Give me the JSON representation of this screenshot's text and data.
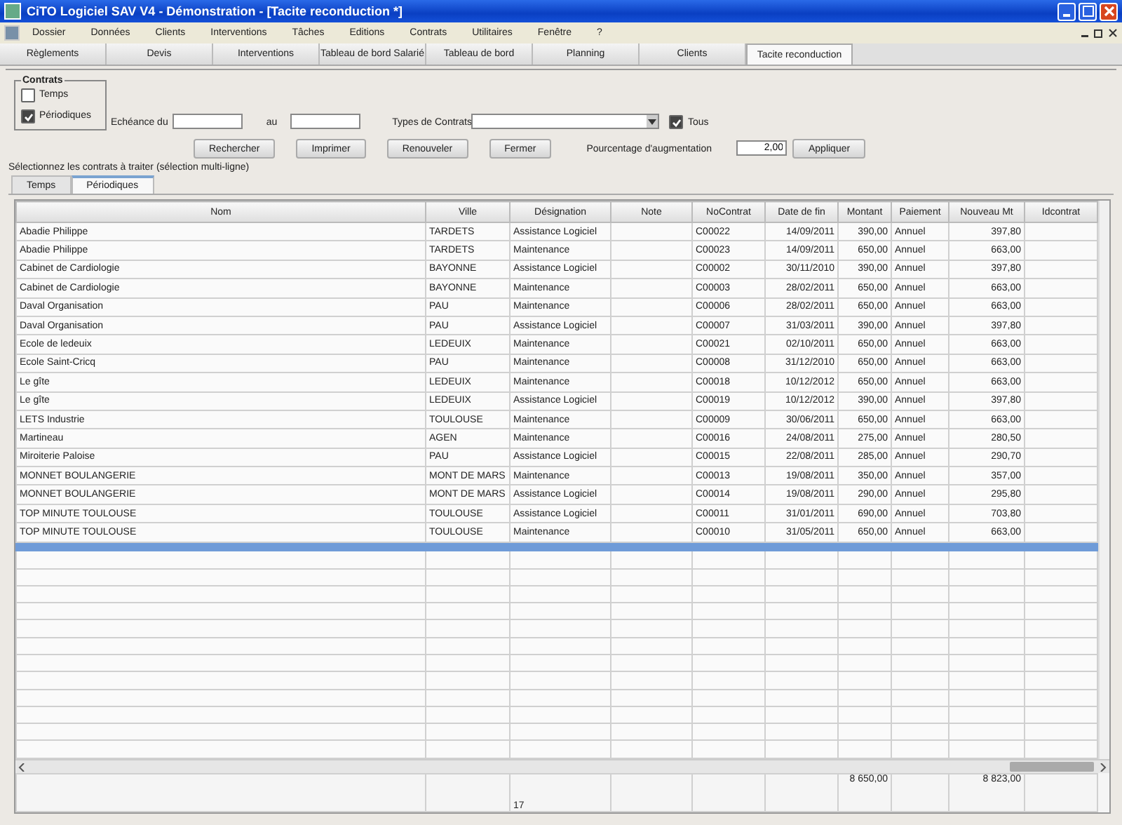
{
  "window": {
    "title": "CiTO Logiciel SAV  V4 - Démonstration - [Tacite reconduction *]"
  },
  "menu": [
    "Dossier",
    "Données",
    "Clients",
    "Interventions",
    "Tâches",
    "Editions",
    "Contrats",
    "Utilitaires",
    "Fenêtre",
    "?"
  ],
  "tabs": [
    {
      "label": "Règlements",
      "selected": false
    },
    {
      "label": "Devis",
      "selected": false
    },
    {
      "label": "Interventions",
      "selected": false
    },
    {
      "label": "Tableau de bord Salarié",
      "selected": false
    },
    {
      "label": "Tableau de bord",
      "selected": false
    },
    {
      "label": "Planning",
      "selected": false
    },
    {
      "label": "Clients",
      "selected": false
    },
    {
      "label": "Tacite reconduction",
      "selected": true
    }
  ],
  "filters": {
    "group_title": "Contrats",
    "options": [
      {
        "label": "Temps",
        "checked": false
      },
      {
        "label": "Périodiques",
        "checked": true
      }
    ],
    "due_from_label": "Echéance du",
    "due_to_label": "au",
    "types_label": "Types de Contrats",
    "all": {
      "label": "Tous",
      "checked": true
    }
  },
  "actions": [
    "Rechercher",
    "Imprimer",
    "Renouveler",
    "Fermer"
  ],
  "increase": {
    "label": "Pourcentage d'augmentation",
    "value": "2,00",
    "button": "Appliquer"
  },
  "instruction": "Sélectionnez les contrats à traiter (sélection multi-ligne)",
  "subtabs": [
    {
      "label": "Temps",
      "selected": false
    },
    {
      "label": "Périodiques",
      "selected": true
    }
  ],
  "table": {
    "columns": [
      "Nom",
      "Ville",
      "Désignation",
      "Note",
      "NoContrat",
      "Date de fin",
      "Montant",
      "Paiement",
      "Nouveau Mt",
      "Idcontrat"
    ],
    "rows": [
      [
        "Abadie Philippe",
        "TARDETS",
        "Assistance Logiciel",
        "",
        "C00022",
        "14/09/2011",
        "390,00",
        "Annuel",
        "397,80",
        ""
      ],
      [
        "Abadie Philippe",
        "TARDETS",
        "Maintenance",
        "",
        "C00023",
        "14/09/2011",
        "650,00",
        "Annuel",
        "663,00",
        ""
      ],
      [
        "Cabinet de Cardiologie",
        "BAYONNE",
        "Assistance Logiciel",
        "",
        "C00002",
        "30/11/2010",
        "390,00",
        "Annuel",
        "397,80",
        ""
      ],
      [
        "Cabinet de Cardiologie",
        "BAYONNE",
        "Maintenance",
        "",
        "C00003",
        "28/02/2011",
        "650,00",
        "Annuel",
        "663,00",
        ""
      ],
      [
        "Daval Organisation",
        "PAU",
        "Maintenance",
        "",
        "C00006",
        "28/02/2011",
        "650,00",
        "Annuel",
        "663,00",
        ""
      ],
      [
        "Daval Organisation",
        "PAU",
        "Assistance Logiciel",
        "",
        "C00007",
        "31/03/2011",
        "390,00",
        "Annuel",
        "397,80",
        ""
      ],
      [
        "Ecole de ledeuix",
        "LEDEUIX",
        "Maintenance",
        "",
        "C00021",
        "02/10/2011",
        "650,00",
        "Annuel",
        "663,00",
        ""
      ],
      [
        "Ecole Saint-Cricq",
        "PAU",
        "Maintenance",
        "",
        "C00008",
        "31/12/2010",
        "650,00",
        "Annuel",
        "663,00",
        ""
      ],
      [
        "Le gîte",
        "LEDEUIX",
        "Maintenance",
        "",
        "C00018",
        "10/12/2012",
        "650,00",
        "Annuel",
        "663,00",
        ""
      ],
      [
        "Le gîte",
        "LEDEUIX",
        "Assistance Logiciel",
        "",
        "C00019",
        "10/12/2012",
        "390,00",
        "Annuel",
        "397,80",
        ""
      ],
      [
        "LETS Industrie",
        "TOULOUSE",
        "Maintenance",
        "",
        "C00009",
        "30/06/2011",
        "650,00",
        "Annuel",
        "663,00",
        ""
      ],
      [
        "Martineau",
        "AGEN",
        "Maintenance",
        "",
        "C00016",
        "24/08/2011",
        "275,00",
        "Annuel",
        "280,50",
        ""
      ],
      [
        "Miroiterie Paloise",
        "PAU",
        "Assistance Logiciel",
        "",
        "C00015",
        "22/08/2011",
        "285,00",
        "Annuel",
        "290,70",
        ""
      ],
      [
        "MONNET BOULANGERIE",
        "MONT DE MARS",
        "Maintenance",
        "",
        "C00013",
        "19/08/2011",
        "350,00",
        "Annuel",
        "357,00",
        ""
      ],
      [
        "MONNET BOULANGERIE",
        "MONT DE MARS",
        "Assistance Logiciel",
        "",
        "C00014",
        "19/08/2011",
        "290,00",
        "Annuel",
        "295,80",
        ""
      ],
      [
        "TOP MINUTE TOULOUSE",
        "TOULOUSE",
        "Assistance Logiciel",
        "",
        "C00011",
        "31/01/2011",
        "690,00",
        "Annuel",
        "703,80",
        ""
      ],
      [
        "TOP MINUTE TOULOUSE",
        "TOULOUSE",
        "Maintenance",
        "",
        "C00010",
        "31/05/2011",
        "650,00",
        "Annuel",
        "663,00",
        ""
      ]
    ],
    "new_row": {
      "selected": true
    },
    "footer": {
      "count": "17",
      "amount_total": "8 650,00",
      "new_amount_total": "8 823,00"
    }
  }
}
